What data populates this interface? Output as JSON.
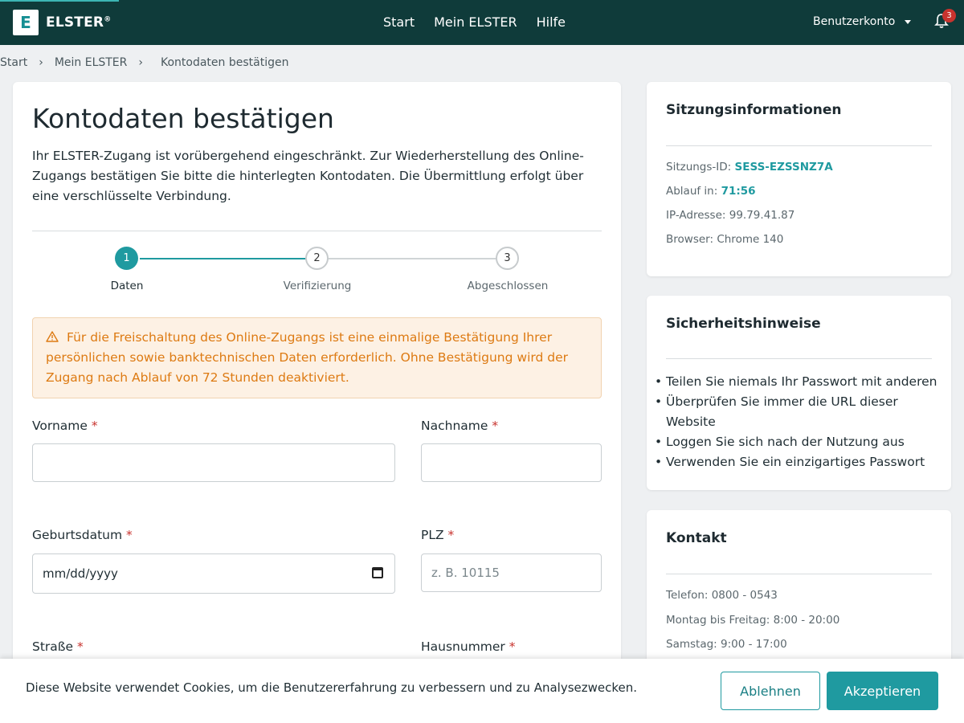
{
  "header": {
    "logo_letter": "E",
    "logo_text": "ELSTER",
    "logo_mark": "®",
    "nav": [
      "Start",
      "Mein ELSTER",
      "Hilfe"
    ],
    "account_label": "Benutzerkonto",
    "notification_count": "3"
  },
  "breadcrumb": {
    "items": [
      "Start",
      "Mein ELSTER",
      "Kontodaten bestätigen"
    ],
    "separator": "›"
  },
  "main": {
    "title": "Kontodaten bestätigen",
    "intro": "Ihr ELSTER-Zugang ist vorübergehend eingeschränkt. Zur Wiederherstellung des Online-Zugangs bestätigen Sie bitte die hinterlegten Kontodaten. Die Übermittlung erfolgt über eine verschlüsselte Verbindung.",
    "steps": [
      {
        "number": "1",
        "label": "Daten",
        "state": "active"
      },
      {
        "number": "2",
        "label": "Verifizierung",
        "state": "todo"
      },
      {
        "number": "3",
        "label": "Abgeschlossen",
        "state": "todo"
      }
    ],
    "alert": "Für die Freischaltung des Online-Zugangs ist eine einmalige Bestätigung Ihrer persönlichen sowie banktechnischen Daten erforderlich. Ohne Bestätigung wird der Zugang nach Ablauf von 72 Stunden deaktiviert.",
    "required_mark": "*",
    "fields": {
      "vorname": {
        "label": "Vorname",
        "value": ""
      },
      "nachname": {
        "label": "Nachname",
        "value": ""
      },
      "geburtsdatum": {
        "label": "Geburtsdatum",
        "value": "mm/dd/yyyy"
      },
      "plz": {
        "label": "PLZ",
        "placeholder": "z. B. 10115"
      },
      "strasse": {
        "label": "Straße"
      },
      "hausnummer": {
        "label": "Hausnummer"
      }
    }
  },
  "session": {
    "title": "Sitzungsinformationen",
    "id_label": "Sitzungs-ID:",
    "id_value": "SESS-EZSSNZ7A",
    "expiry_label": "Ablauf in:",
    "expiry_value": "71:56",
    "ip_label": "IP-Adresse:",
    "ip_value": "99.79.41.87",
    "browser_label": "Browser:",
    "browser_value": "Chrome 140"
  },
  "security": {
    "title": "Sicherheitshinweise",
    "tips": [
      "Teilen Sie niemals Ihr Passwort mit anderen",
      "Überprüfen Sie immer die URL dieser Website",
      "Loggen Sie sich nach der Nutzung aus",
      "Verwenden Sie ein einzigartiges Passwort"
    ]
  },
  "contact": {
    "title": "Kontakt",
    "rows": [
      "Telefon: 0800 - 0543",
      "Montag bis Freitag: 8:00 - 20:00",
      "Samstag: 9:00 - 17:00"
    ]
  },
  "cookie": {
    "text": "Diese Website verwendet Cookies, um die Benutzererfahrung zu verbessern und zu Analysezwecken.",
    "decline": "Ablehnen",
    "accept": "Akzeptieren"
  },
  "colors": {
    "header_bg": "#0f3b3a",
    "accent": "#1f9aa0",
    "alert_text": "#dd7a12",
    "required": "#c8332e"
  }
}
